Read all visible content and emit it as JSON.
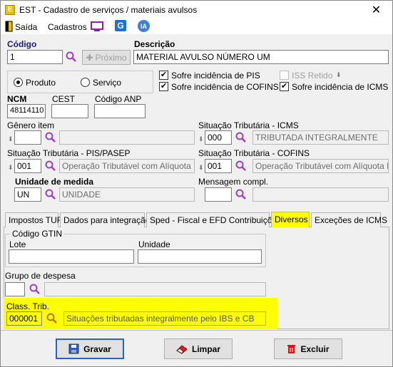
{
  "window": {
    "title": "EST - Cadastro de serviços / materiais avulsos",
    "close": "✕"
  },
  "menu": {
    "saida": "Saída",
    "cadastros": "Cadastros",
    "ia": "IA"
  },
  "codigo": {
    "label": "Código",
    "value": "1",
    "proximo": "Próximo"
  },
  "descricao": {
    "label": "Descrição",
    "value": "MATERIAL AVULSO NÚMERO UM"
  },
  "tipo": {
    "produto": "Produto",
    "servico": "Serviço",
    "selected": "Produto"
  },
  "checks": {
    "pis": "Sofre incidência de PIS",
    "cofins": "Sofre incidência de COFINS",
    "iss": "ISS Retido",
    "icms": "Sofre incidência de ICMS"
  },
  "ncm": {
    "label": "NCM",
    "value": "48114110"
  },
  "cest": {
    "label": "CEST",
    "value": ""
  },
  "anp": {
    "label": "Código ANP",
    "value": ""
  },
  "genero": {
    "label": "Gênero item",
    "value": "",
    "desc": ""
  },
  "sit_icms": {
    "label": "Situação Tributária - ICMS",
    "value": "000",
    "desc": "TRIBUTADA INTEGRALMENTE"
  },
  "sit_pis": {
    "label": "Situação Tributária - PIS/PASEP",
    "value": "001",
    "desc": "Operação Tributável com Alíquota Bási"
  },
  "sit_cofins": {
    "label": "Situação Tributária - COFINS",
    "value": "001",
    "desc": "Operação Tributável com Alíquota Bási"
  },
  "unidade": {
    "label": "Unidade de medida",
    "value": "UN",
    "desc": "UNIDADE"
  },
  "mensagem": {
    "label": "Mensagem compl.",
    "value": "",
    "desc": ""
  },
  "tabs": [
    "Impostos TUR",
    "Dados para integração",
    "Sped - Fiscal e EFD Contribuições",
    "Diversos",
    "Exceções de ICMS"
  ],
  "gtin": {
    "title": "Código GTIN",
    "lote": "Lote",
    "unidade": "Unidade"
  },
  "grupo": {
    "label": "Grupo de despesa",
    "value": "",
    "desc": ""
  },
  "class_trib": {
    "label": "Class. Trib.",
    "value": "000001",
    "desc": "Situações tributadas integralmente pelo IBS e CB"
  },
  "buttons": {
    "gravar": "Gravar",
    "limpar": "Limpar",
    "excluir": "Excluir"
  },
  "colors": {
    "highlight": "#ffff00",
    "label_blue": "#1a1a80",
    "search": "#a040c0"
  }
}
